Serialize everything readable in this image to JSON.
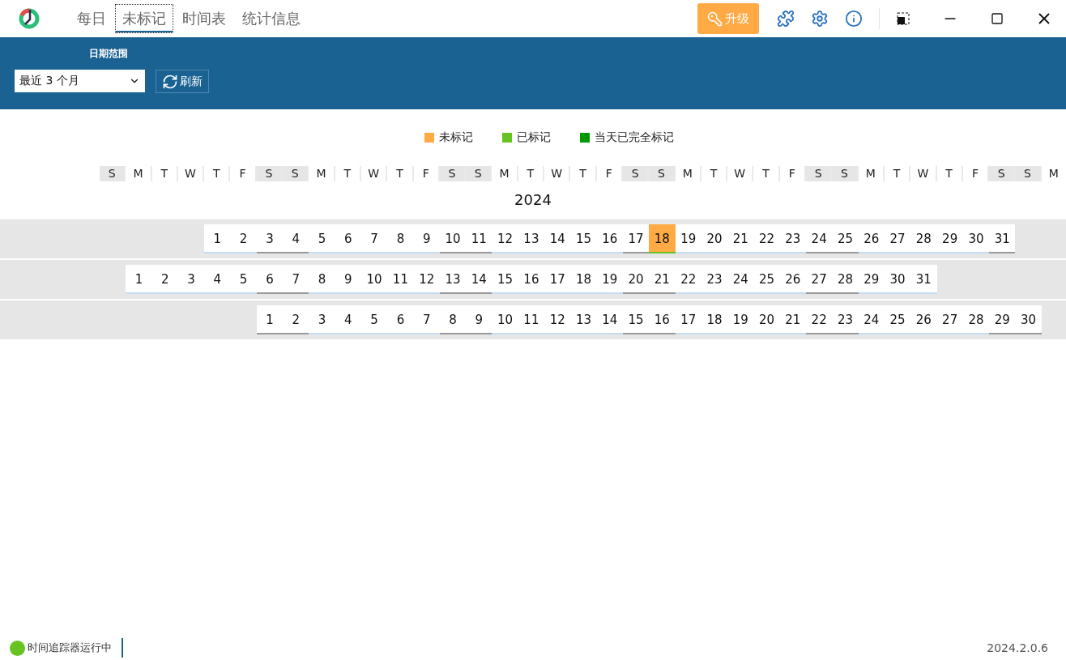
{
  "tabs": [
    {
      "label": "每日",
      "selected": false
    },
    {
      "label": "未标记",
      "selected": true
    },
    {
      "label": "时间表",
      "selected": false
    },
    {
      "label": "统计信息",
      "selected": false
    }
  ],
  "upgrade_button": "升级",
  "toolbar": {
    "date_range_label": "日期范围",
    "date_range_value": "最近 3 个月",
    "refresh_button": "刷新"
  },
  "legend": [
    {
      "label": "未标记",
      "color": "#ffaa44"
    },
    {
      "label": "已标记",
      "color": "#66c322"
    },
    {
      "label": "当天已完全标记",
      "color": "#009a00"
    }
  ],
  "weekday_header": [
    "S",
    "M",
    "T",
    "W",
    "T",
    "F",
    "S",
    "S",
    "M",
    "T",
    "W",
    "T",
    "F",
    "S",
    "S",
    "M",
    "T",
    "W",
    "T",
    "F",
    "S",
    "S",
    "M",
    "T",
    "W",
    "T",
    "F",
    "S",
    "S",
    "M",
    "T",
    "W",
    "T",
    "F",
    "S",
    "S",
    "M"
  ],
  "year": "2024",
  "months": [
    {
      "kind": "thursday",
      "days": [
        {
          "label": "1",
          "unmarked": false
        },
        {
          "label": "2",
          "unmarked": false
        },
        {
          "label": "3",
          "unmarked": false
        },
        {
          "label": "4",
          "unmarked": false
        },
        {
          "label": "5",
          "unmarked": false
        },
        {
          "label": "6",
          "unmarked": false
        },
        {
          "label": "7",
          "unmarked": false
        },
        {
          "label": "8",
          "unmarked": false
        },
        {
          "label": "9",
          "unmarked": false
        },
        {
          "label": "10",
          "unmarked": false
        },
        {
          "label": "11",
          "unmarked": false
        },
        {
          "label": "12",
          "unmarked": false
        },
        {
          "label": "13",
          "unmarked": false
        },
        {
          "label": "14",
          "unmarked": false
        },
        {
          "label": "15",
          "unmarked": false
        },
        {
          "label": "16",
          "unmarked": false
        },
        {
          "label": "17",
          "unmarked": false
        },
        {
          "label": "18",
          "unmarked": true
        },
        {
          "label": "19",
          "unmarked": false
        },
        {
          "label": "20",
          "unmarked": false
        },
        {
          "label": "21",
          "unmarked": false
        },
        {
          "label": "22",
          "unmarked": false
        },
        {
          "label": "23",
          "unmarked": false
        },
        {
          "label": "24",
          "unmarked": false
        },
        {
          "label": "25",
          "unmarked": false
        },
        {
          "label": "26",
          "unmarked": false
        },
        {
          "label": "27",
          "unmarked": false
        },
        {
          "label": "28",
          "unmarked": false
        },
        {
          "label": "29",
          "unmarked": false
        },
        {
          "label": "30",
          "unmarked": false
        },
        {
          "label": "31",
          "unmarked": false
        }
      ]
    },
    {
      "kind": "monday",
      "days": [
        {
          "label": "1",
          "unmarked": false
        },
        {
          "label": "2",
          "unmarked": false
        },
        {
          "label": "3",
          "unmarked": false
        },
        {
          "label": "4",
          "unmarked": false
        },
        {
          "label": "5",
          "unmarked": false
        },
        {
          "label": "6",
          "unmarked": false
        },
        {
          "label": "7",
          "unmarked": false
        },
        {
          "label": "8",
          "unmarked": false
        },
        {
          "label": "9",
          "unmarked": false
        },
        {
          "label": "10",
          "unmarked": false
        },
        {
          "label": "11",
          "unmarked": false
        },
        {
          "label": "12",
          "unmarked": false
        },
        {
          "label": "13",
          "unmarked": false
        },
        {
          "label": "14",
          "unmarked": false
        },
        {
          "label": "15",
          "unmarked": false
        },
        {
          "label": "16",
          "unmarked": false
        },
        {
          "label": "17",
          "unmarked": false
        },
        {
          "label": "18",
          "unmarked": false
        },
        {
          "label": "19",
          "unmarked": false
        },
        {
          "label": "20",
          "unmarked": false
        },
        {
          "label": "21",
          "unmarked": false
        },
        {
          "label": "22",
          "unmarked": false
        },
        {
          "label": "23",
          "unmarked": false
        },
        {
          "label": "24",
          "unmarked": false
        },
        {
          "label": "25",
          "unmarked": false
        },
        {
          "label": "26",
          "unmarked": false
        },
        {
          "label": "27",
          "unmarked": false
        },
        {
          "label": "28",
          "unmarked": false
        },
        {
          "label": "29",
          "unmarked": false
        },
        {
          "label": "30",
          "unmarked": false
        },
        {
          "label": "31",
          "unmarked": false
        }
      ]
    },
    {
      "kind": "saturday",
      "days": [
        {
          "label": "1",
          "unmarked": false
        },
        {
          "label": "2",
          "unmarked": false
        },
        {
          "label": "3",
          "unmarked": false
        },
        {
          "label": "4",
          "unmarked": false
        },
        {
          "label": "5",
          "unmarked": false
        },
        {
          "label": "6",
          "unmarked": false
        },
        {
          "label": "7",
          "unmarked": false
        },
        {
          "label": "8",
          "unmarked": false
        },
        {
          "label": "9",
          "unmarked": false
        },
        {
          "label": "10",
          "unmarked": false
        },
        {
          "label": "11",
          "unmarked": false
        },
        {
          "label": "12",
          "unmarked": false
        },
        {
          "label": "13",
          "unmarked": false
        },
        {
          "label": "14",
          "unmarked": false
        },
        {
          "label": "15",
          "unmarked": false
        },
        {
          "label": "16",
          "unmarked": false
        },
        {
          "label": "17",
          "unmarked": false
        },
        {
          "label": "18",
          "unmarked": false
        },
        {
          "label": "19",
          "unmarked": false
        },
        {
          "label": "20",
          "unmarked": false
        },
        {
          "label": "21",
          "unmarked": false
        },
        {
          "label": "22",
          "unmarked": false
        },
        {
          "label": "23",
          "unmarked": false
        },
        {
          "label": "24",
          "unmarked": false
        },
        {
          "label": "25",
          "unmarked": false
        },
        {
          "label": "26",
          "unmarked": false
        },
        {
          "label": "27",
          "unmarked": false
        },
        {
          "label": "28",
          "unmarked": false
        },
        {
          "label": "29",
          "unmarked": false
        },
        {
          "label": "30",
          "unmarked": false
        }
      ]
    }
  ],
  "status_bar": {
    "running": true,
    "status_text": "时间追踪器运行中",
    "version": "2024.2.0.6"
  }
}
